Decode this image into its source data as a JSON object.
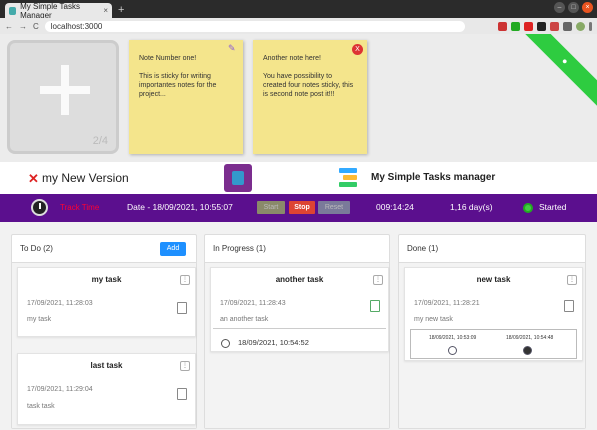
{
  "browser": {
    "tab_title": "My Simple Tasks Manager",
    "tab_close": "×",
    "new_tab": "+",
    "url": "localhost:3000",
    "back": "←",
    "forward": "→",
    "reload": "C"
  },
  "notes": {
    "counter": "2/4",
    "items": [
      {
        "lines": [
          "Note Number one!",
          "This is sticky for writing importantes notes for the project..."
        ]
      },
      {
        "lines": [
          "Another note here!",
          "You have possibility to created four notes sticky, this is second note post it!!!"
        ]
      }
    ],
    "delete_label": "X",
    "ribbon_icon": "github-icon"
  },
  "header": {
    "version_close": "✕",
    "version": "my New Version",
    "app_name": "My Simple Tasks manager"
  },
  "tracker": {
    "label": "Track Time",
    "date": "Date - 18/09/2021, 10:55:07",
    "start": "Start",
    "stop": "Stop",
    "reset": "Reset",
    "elapsed": "009:14:24",
    "days": "1,16 day(s)",
    "status": "Started"
  },
  "columns": {
    "todo": {
      "title": "To Do (2)",
      "add": "Add",
      "cards": [
        {
          "title": "my task",
          "ts": "17/09/2021, 11:28:03",
          "desc": "my task"
        },
        {
          "title": "last task",
          "ts": "17/09/2021, 11:29:04",
          "desc": "task task"
        }
      ]
    },
    "progress": {
      "title": "In Progress (1)",
      "cards": [
        {
          "title": "another task",
          "ts": "17/09/2021, 11:28:43",
          "desc": "an another task",
          "timer": "18/09/2021, 10:54:52"
        }
      ]
    },
    "done": {
      "title": "Done (1)",
      "cards": [
        {
          "title": "new task",
          "ts": "17/09/2021, 11:28:21",
          "desc": "my new task",
          "start": "18/09/2021, 10:53:09",
          "end": "18/09/2021, 10:54:48"
        }
      ]
    }
  },
  "colors": {
    "tracker_bg": "#5b0f8e",
    "note_bg": "#f4e58c",
    "accent": "#1e90ff",
    "stop": "#dd4433",
    "status_green": "#44cc44"
  }
}
